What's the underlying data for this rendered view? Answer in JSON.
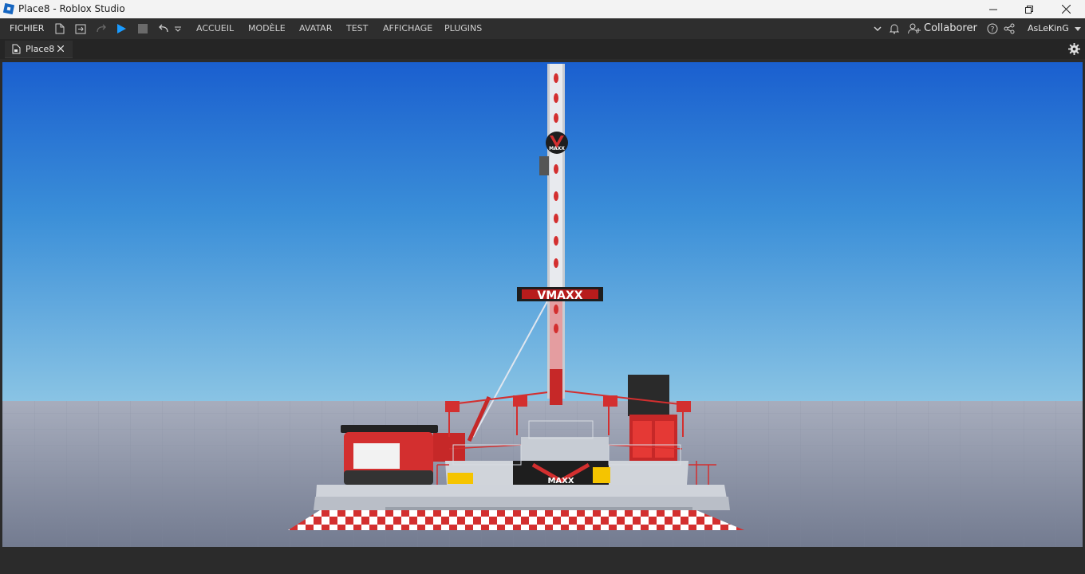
{
  "window": {
    "title": "Place8 - Roblox Studio"
  },
  "ribbon": {
    "file_label": "FICHIER",
    "tabs": [
      {
        "label": "ACCUEIL"
      },
      {
        "label": "MODÈLE"
      },
      {
        "label": "AVATAR"
      },
      {
        "label": "TEST"
      },
      {
        "label": "AFFICHAGE"
      },
      {
        "label": "PLUGINS"
      }
    ],
    "collaborate_label": "Collaborer",
    "username": "AsLeKinG"
  },
  "tabs": {
    "document_tab": "Place8"
  },
  "viewport": {
    "ride_sign_text": "VMAXX",
    "tower_logo_text": "MAXX",
    "base_sign_text": "MAXX"
  },
  "colors": {
    "ride_red": "#d32f2f",
    "sky_top": "#1a5fcf",
    "sky_horizon": "#8ac4e4",
    "ground": "#8e95a8",
    "play_blue": "#1a9bff"
  }
}
